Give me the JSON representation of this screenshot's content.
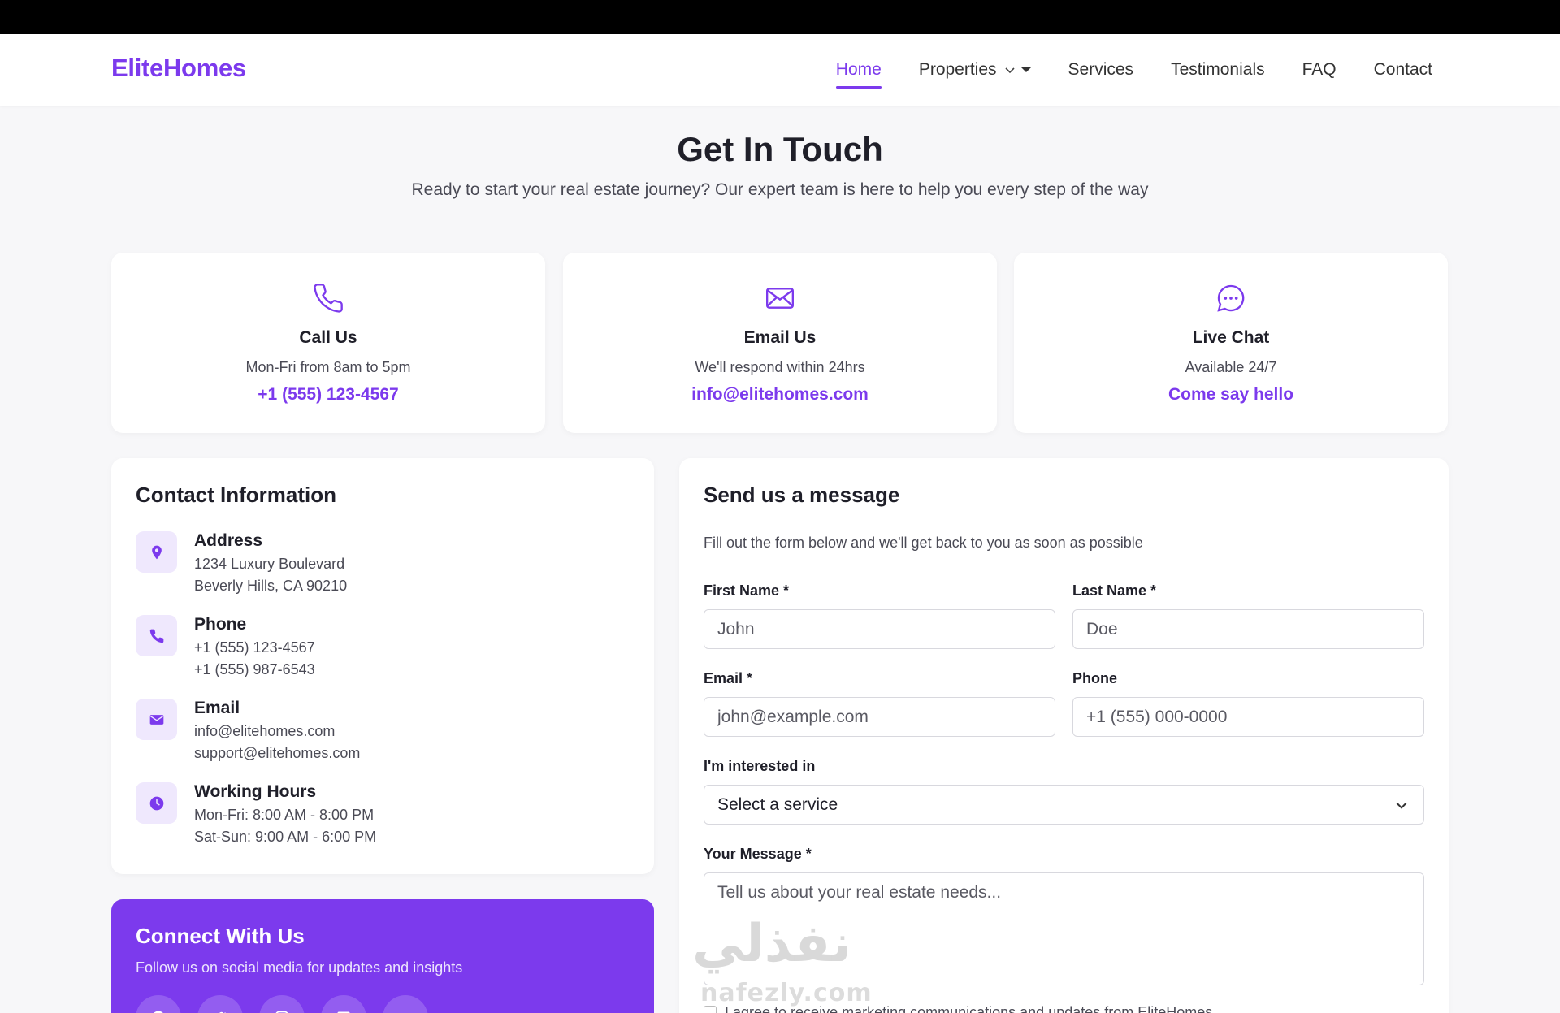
{
  "brand": {
    "name": "EliteHomes",
    "color": "#7c3aed"
  },
  "nav": {
    "items": [
      {
        "label": "Home",
        "active": true
      },
      {
        "label": "Properties",
        "dropdown": true
      },
      {
        "label": "Services"
      },
      {
        "label": "Testimonials"
      },
      {
        "label": "FAQ"
      },
      {
        "label": "Contact"
      }
    ]
  },
  "hero": {
    "title": "Get In Touch",
    "subtitle": "Ready to start your real estate journey? Our expert team is here to help you every step of the way"
  },
  "quick_contacts": [
    {
      "icon": "phone-icon",
      "title": "Call Us",
      "desc": "Mon-Fri from 8am to 5pm",
      "link": "+1 (555) 123-4567"
    },
    {
      "icon": "mail-icon",
      "title": "Email Us",
      "desc": "We'll respond within 24hrs",
      "link": "info@elitehomes.com"
    },
    {
      "icon": "chat-icon",
      "title": "Live Chat",
      "desc": "Available 24/7",
      "link": "Come say hello"
    }
  ],
  "contact_info": {
    "title": "Contact Information",
    "items": [
      {
        "icon": "location-pin-icon",
        "head": "Address",
        "lines": [
          "1234 Luxury Boulevard",
          "Beverly Hills, CA 90210"
        ]
      },
      {
        "icon": "phone-icon",
        "head": "Phone",
        "lines": [
          "+1 (555) 123-4567",
          "+1 (555) 987-6543"
        ]
      },
      {
        "icon": "mail-icon",
        "head": "Email",
        "lines": [
          "info@elitehomes.com",
          "support@elitehomes.com"
        ]
      },
      {
        "icon": "clock-icon",
        "head": "Working Hours",
        "lines": [
          "Mon-Fri: 8:00 AM - 8:00 PM",
          "Sat-Sun: 9:00 AM - 6:00 PM"
        ]
      }
    ]
  },
  "connect": {
    "title": "Connect With Us",
    "subtitle": "Follow us on social media for updates and insights",
    "socials": [
      "facebook-icon",
      "twitter-icon",
      "instagram-icon",
      "linkedin-icon",
      "youtube-icon"
    ]
  },
  "form": {
    "title": "Send us a message",
    "subtitle": "Fill out the form below and we'll get back to you as soon as possible",
    "first_name": {
      "label": "First Name *",
      "placeholder": "John"
    },
    "last_name": {
      "label": "Last Name *",
      "placeholder": "Doe"
    },
    "email": {
      "label": "Email *",
      "placeholder": "john@example.com"
    },
    "phone": {
      "label": "Phone",
      "placeholder": "+1 (555) 000-0000"
    },
    "interest": {
      "label": "I'm interested in",
      "selected": "Select a service"
    },
    "message": {
      "label": "Your Message *",
      "placeholder": "Tell us about your real estate needs..."
    },
    "consent": "I agree to receive marketing communications and updates from EliteHomes"
  },
  "watermark": {
    "arabic": "نفذلي",
    "latin": "nafezly.com"
  }
}
